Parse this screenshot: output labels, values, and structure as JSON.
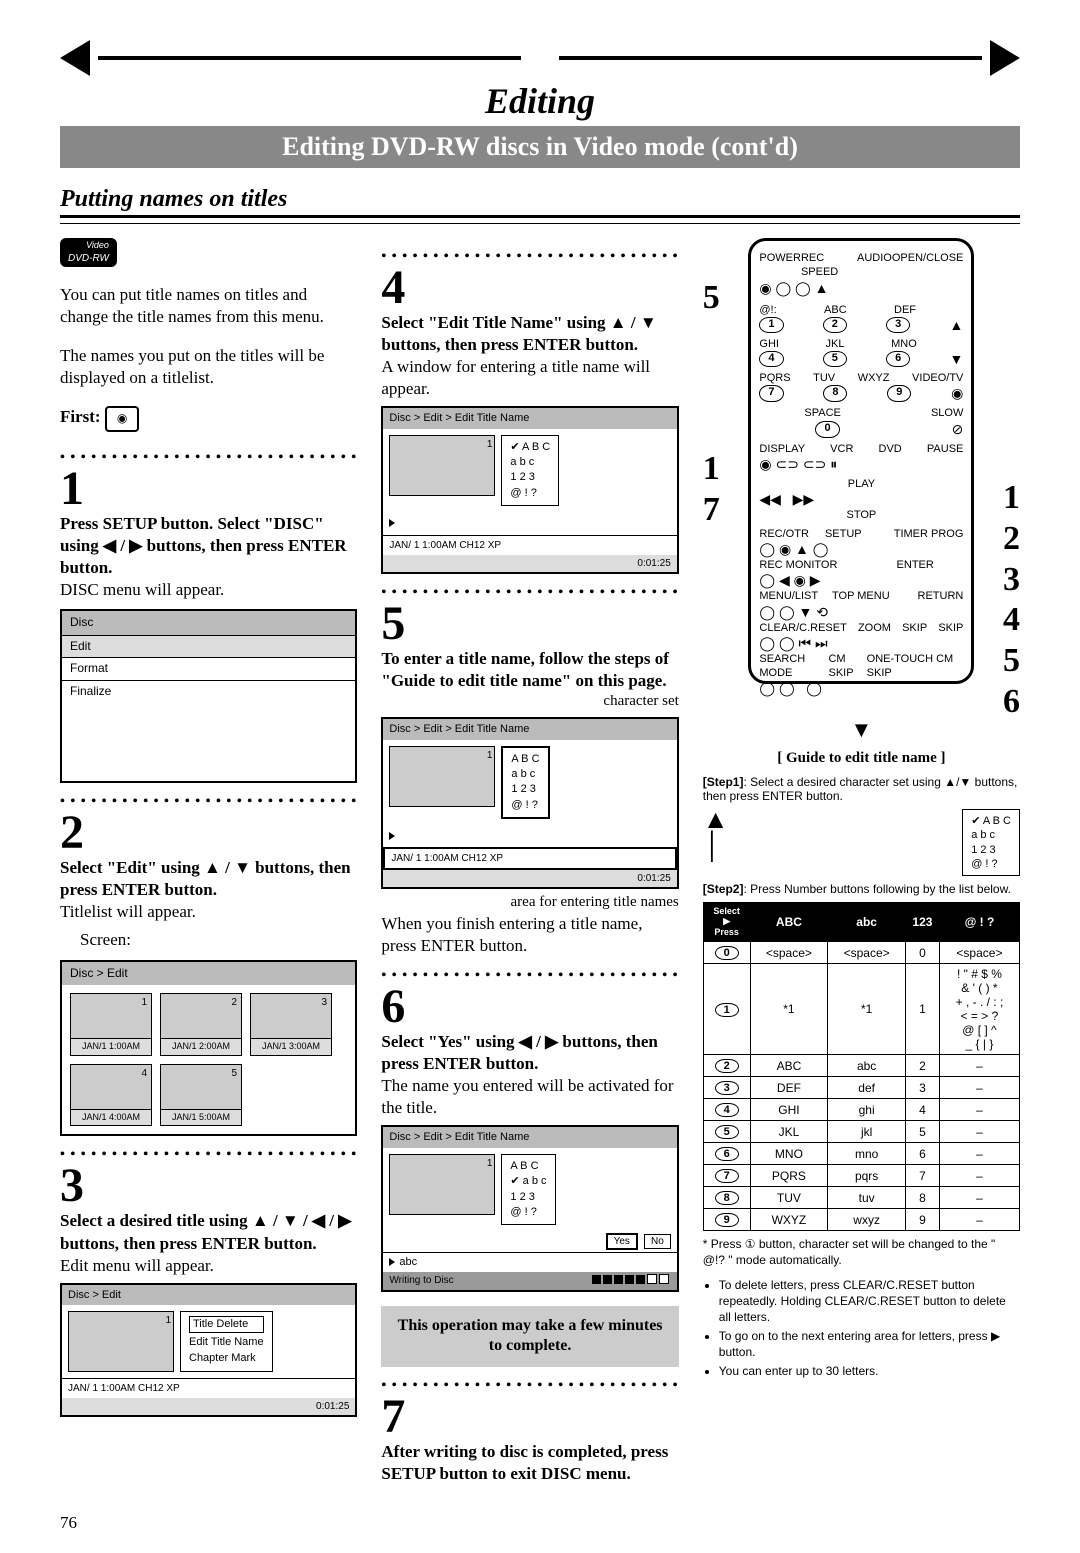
{
  "page_number": "76",
  "header": {
    "title": "Editing",
    "subtitle": "Editing DVD-RW discs in Video mode (cont'd)"
  },
  "section_title": "Putting names on titles",
  "badge": {
    "top": "Video",
    "bottom": "DVD-RW"
  },
  "intro": {
    "p1": "You can put title names on titles and change the title names from this menu.",
    "p2": "The names you put on the titles will be displayed on a titlelist.",
    "first_label": "First:"
  },
  "steps": {
    "s1": {
      "num": "1",
      "head": "Press SETUP button. Select \"DISC\" using ◀ / ▶ buttons, then press ENTER button.",
      "body": "DISC menu will appear.",
      "panel_title": "Disc",
      "panel_items": [
        "Edit",
        "Format",
        "Finalize"
      ]
    },
    "s2": {
      "num": "2",
      "head": "Select \"Edit\" using ▲ / ▼ buttons, then press ENTER button.",
      "body": "Titlelist will appear.",
      "screen_label": "Screen:",
      "grid_header": "Disc > Edit",
      "thumbs": [
        "JAN/1  1:00AM",
        "JAN/1  2:00AM",
        "JAN/1  3:00AM",
        "JAN/1  4:00AM",
        "JAN/1  5:00AM"
      ]
    },
    "s3": {
      "num": "3",
      "head": "Select a desired title using ▲ / ▼ / ◀ / ▶ buttons, then press ENTER button.",
      "body": "Edit menu will appear.",
      "crumb": "Disc > Edit",
      "menu": [
        "Title Delete",
        "Edit Title Name",
        "Chapter Mark"
      ],
      "status": "JAN/ 1   1:00AM  CH12    XP",
      "time": "0:01:25"
    },
    "s4": {
      "num": "4",
      "head": "Select \"Edit Title Name\" using ▲ / ▼ buttons, then press ENTER button.",
      "body": "A window for entering a title name will appear.",
      "crumb": "Disc > Edit > Edit Title Name",
      "opts": [
        "✔  A B C",
        "a b c",
        "1 2 3",
        "@ ! ?"
      ],
      "status": "JAN/ 1   1:00AM   CH12   XP",
      "time": "0:01:25"
    },
    "s5": {
      "num": "5",
      "head": "To enter a title name, follow the steps of \"Guide to edit title name\" on this page.",
      "cap_charset": "character set",
      "crumb": "Disc > Edit > Edit Title Name",
      "opts": [
        "A B C",
        "a b c",
        "1 2 3",
        "@ ! ?"
      ],
      "status": "JAN/ 1   1:00AM   CH12   XP",
      "time": "0:01:25",
      "cap_area": "area for entering title names",
      "after": "When you finish entering a title name, press ENTER button."
    },
    "s6": {
      "num": "6",
      "head": "Select \"Yes\" using ◀ / ▶ buttons, then press ENTER button.",
      "body": "The name you entered will be activated for the title.",
      "crumb": "Disc > Edit > Edit Title Name",
      "opts": [
        "A B C",
        "✔  a b c",
        "1 2 3",
        "@ ! ?"
      ],
      "yn": [
        "Yes",
        "No"
      ],
      "entry": "abc",
      "writing": "Writing to Disc",
      "note": "This operation may take a few minutes to complete."
    },
    "s7": {
      "num": "7",
      "head": "After writing to disc is completed, press SETUP button to exit DISC menu."
    }
  },
  "leftcall": [
    "5",
    "",
    "",
    "1",
    "7"
  ],
  "rightcall": [
    "1",
    "2",
    "3",
    "4",
    "5",
    "6"
  ],
  "guide": {
    "title": "[ Guide to edit title name ]",
    "step1_label": "[Step1]",
    "step1_text": ": Select a desired character set using ▲/▼ buttons, then press ENTER button.",
    "step1_box": [
      "✔  A B C",
      "a b c",
      "1 2 3",
      "@ ! ?"
    ],
    "step2_label": "[Step2]",
    "step2_text": ": Press Number buttons following by the list below.",
    "table": {
      "head": [
        "ABC",
        "abc",
        "123",
        "@ ! ?"
      ],
      "rows": [
        {
          "k": "0",
          "v": [
            "<space>",
            "<space>",
            "0",
            "<space>"
          ]
        },
        {
          "k": "1",
          "v": [
            "*1",
            "*1",
            "1",
            "! \" # $ %\n& ' ( ) *\n+ , - . / : ;\n< = > ?\n@ [ ] ^\n_ { | }"
          ]
        },
        {
          "k": "2",
          "v": [
            "ABC",
            "abc",
            "2",
            "–"
          ]
        },
        {
          "k": "3",
          "v": [
            "DEF",
            "def",
            "3",
            "–"
          ]
        },
        {
          "k": "4",
          "v": [
            "GHI",
            "ghi",
            "4",
            "–"
          ]
        },
        {
          "k": "5",
          "v": [
            "JKL",
            "jkl",
            "5",
            "–"
          ]
        },
        {
          "k": "6",
          "v": [
            "MNO",
            "mno",
            "6",
            "–"
          ]
        },
        {
          "k": "7",
          "v": [
            "PQRS",
            "pqrs",
            "7",
            "–"
          ]
        },
        {
          "k": "8",
          "v": [
            "TUV",
            "tuv",
            "8",
            "–"
          ]
        },
        {
          "k": "9",
          "v": [
            "WXYZ",
            "wxyz",
            "9",
            "–"
          ]
        }
      ]
    },
    "asterisk": "* Press ① button, character set will be changed to the \" @!? \" mode automatically.",
    "notes": [
      "To delete letters, press CLEAR/C.RESET button repeatedly. Holding CLEAR/C.RESET button to delete all letters.",
      "To go on to the next entering area for letters, press ▶ button.",
      "You can enter up to 30 letters."
    ]
  },
  "remote_labels": {
    "row1": [
      "POWER",
      "REC SPEED",
      "AUDIO",
      "OPEN/CLOSE"
    ],
    "row2": [
      "@!:",
      "ABC",
      "DEF",
      ""
    ],
    "row2n": [
      "1",
      "2",
      "3",
      ""
    ],
    "row3": [
      "GHI",
      "JKL",
      "MNO",
      ""
    ],
    "row3n": [
      "4",
      "5",
      "6",
      ""
    ],
    "row4": [
      "PQRS",
      "TUV",
      "WXYZ",
      "VIDEO/TV"
    ],
    "row4n": [
      "7",
      "8",
      "9",
      ""
    ],
    "row5": [
      "",
      "SPACE",
      "",
      "SLOW"
    ],
    "row5n": [
      "",
      "0",
      "",
      ""
    ],
    "row6": [
      "DISPLAY",
      "VCR",
      "DVD",
      "PAUSE"
    ],
    "plbl": "PLAY",
    "slbl": "STOP",
    "row7": [
      "REC/OTR",
      "SETUP",
      "",
      "TIMER PROG"
    ],
    "row8": [
      "REC MONITOR",
      "",
      "ENTER",
      ""
    ],
    "row9": [
      "MENU/LIST",
      "TOP MENU",
      "",
      "RETURN"
    ],
    "row10": [
      "CLEAR/C.RESET",
      "ZOOM",
      "SKIP",
      "SKIP"
    ],
    "row11": [
      "SEARCH MODE",
      "CM SKIP",
      "",
      "ONE-TOUCH CM SKIP"
    ]
  }
}
